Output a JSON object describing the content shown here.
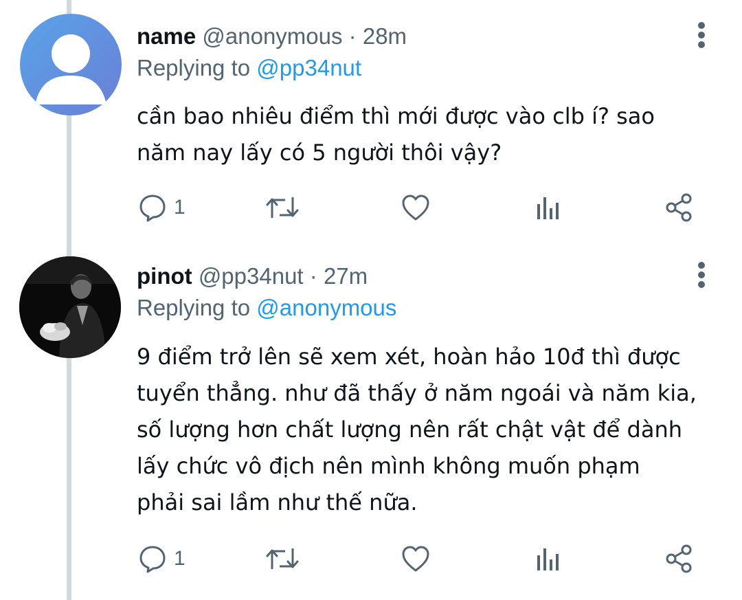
{
  "tweets": [
    {
      "display_name": "name",
      "handle": "@anonymous",
      "separator": "·",
      "time": "28m",
      "replying_prefix": "Replying to",
      "replying_to": "@pp34nut",
      "text": "cần bao nhiêu điểm thì mới được vào clb í? sao\nnăm nay lấy có 5 người thôi vậy?",
      "reply_count": "1",
      "avatar": "default-profile-icon"
    },
    {
      "display_name": "pinot",
      "handle": "@pp34nut",
      "separator": "·",
      "time": "27m",
      "replying_prefix": "Replying to",
      "replying_to": "@anonymous",
      "text": "9 điểm trở lên sẽ xem xét, hoàn hảo 10đ thì được\ntuyển thẳng. như đã thấy ở năm ngoái và năm kia,\nsố lượng hơn chất lượng nên rất chật vật để dành\nlấy chức vô địch nên mình không muốn phạm\nphải sai lầm như thế nữa.",
      "reply_count": "1",
      "avatar": "profile-photo"
    }
  ],
  "icons": [
    "reply-icon",
    "retweet-icon",
    "like-icon",
    "analytics-icon",
    "share-icon",
    "more-options-icon"
  ],
  "colors": {
    "link": "#1d9bf0",
    "secondary_text": "#536471",
    "thread_line": "#cfd9de",
    "icon": "#536471"
  }
}
